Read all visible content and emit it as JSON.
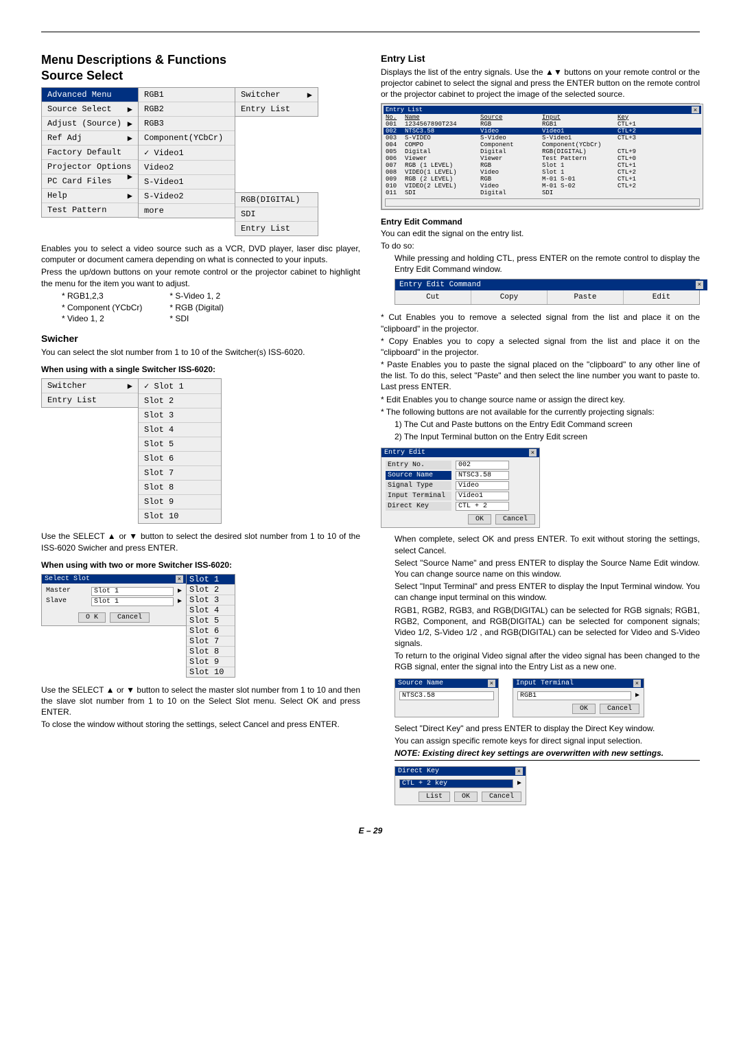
{
  "page_number": "E – 29",
  "left": {
    "h1a": "Menu Descriptions & Functions",
    "h1b": "Source Select",
    "advanced_menu": {
      "title": "Advanced Menu",
      "items": [
        {
          "label": "Source Select",
          "arrow": true
        },
        {
          "label": "Adjust (Source)",
          "arrow": true
        },
        {
          "label": "Ref Adj",
          "arrow": true
        },
        {
          "label": "Factory Default"
        },
        {
          "label": "Projector Options",
          "arrow": true
        },
        {
          "label": "PC Card Files"
        },
        {
          "label": "Help",
          "arrow": true
        },
        {
          "label": "Test Pattern"
        }
      ]
    },
    "source_col1": [
      "RGB1",
      "RGB2",
      "RGB3",
      "Component(YCbCr)",
      "Video1",
      "Video2",
      "S-Video1",
      "S-Video2",
      "more"
    ],
    "source_video1_checked": true,
    "source_col2a": [
      "Switcher",
      "Entry List"
    ],
    "source_col2b": [
      "RGB(DIGITAL)",
      "SDI",
      "Entry List"
    ],
    "p1": "Enables you to select a video source such as a VCR, DVD player, laser disc player, computer or document camera depending on what is connected to your inputs.",
    "p2": "Press the up/down buttons on your remote control or the projector cabinet to highlight the menu for the item you want to adjust.",
    "src_left": [
      "* RGB1,2,3",
      "* Component (YCbCr)",
      "* Video 1, 2"
    ],
    "src_right": [
      "* S-Video 1, 2",
      "* RGB (Digital)",
      "* SDI"
    ],
    "h2_swicher": "Swicher",
    "sw_p1": "You can select the slot number from 1 to 10 of the Switcher(s) ISS-6020.",
    "sw_h3a": "When using with a single Switcher ISS-6020:",
    "sw_menu_left": [
      "Switcher",
      "Entry List"
    ],
    "sw_slots": [
      "Slot 1",
      "Slot 2",
      "Slot 3",
      "Slot 4",
      "Slot 5",
      "Slot 6",
      "Slot 7",
      "Slot 8",
      "Slot 9",
      "Slot 10"
    ],
    "sw_p2": "Use the SELECT ▲ or ▼ button to select the desired slot number from 1 to 10 of the ISS-6020 Swicher and press ENTER.",
    "sw_h3b": "When using with two or more Switcher ISS-6020:",
    "select_slot": {
      "title": "Select Slot",
      "rows": [
        {
          "label": "Master",
          "value": "Slot 1"
        },
        {
          "label": "Slave",
          "value": "Slot 1"
        }
      ],
      "ok": "O K",
      "cancel": "Cancel",
      "dropdown": [
        "Slot 1",
        "Slot 2",
        "Slot 3",
        "Slot 4",
        "Slot 5",
        "Slot 6",
        "Slot 7",
        "Slot 8",
        "Slot 9",
        "Slot 10"
      ]
    },
    "sw_p3": "Use the SELECT ▲ or ▼ button to select the master slot number from 1 to 10 and then the slave slot number from 1 to 10 on the Select Slot menu. Select OK and press ENTER.",
    "sw_p4": "To close the window without storing the settings, select Cancel and press ENTER."
  },
  "right": {
    "h2_entry": "Entry List",
    "el_p1": "Displays the list of the entry signals. Use the ▲▼ buttons on your remote control or the projector cabinet to select the signal and press the ENTER button on the remote control or the projector cabinet to project the image of the selected source.",
    "entry_list": {
      "title": "Entry List",
      "headers": [
        "No.",
        "Name",
        "Source",
        "Input",
        "Key"
      ],
      "rows": [
        [
          "001",
          "1234567890T234",
          "RGB",
          "RGB1",
          "CTL+1"
        ],
        [
          "002",
          "NTSC3.58",
          "Video",
          "Video1",
          "CTL+2"
        ],
        [
          "003",
          "S-VIDEO",
          "S-Video",
          "S-Video1",
          "CTL+3"
        ],
        [
          "004",
          "COMPO",
          "Component",
          "Component(YCbCr)",
          ""
        ],
        [
          "005",
          "Digital",
          "Digital",
          "RGB(DIGITAL)",
          "CTL+9"
        ],
        [
          "006",
          "Viewer",
          "Viewer",
          "Test Pattern",
          "CTL+0"
        ],
        [
          "007",
          "RGB   (1 LEVEL)",
          "RGB",
          "Slot 1",
          "CTL+1"
        ],
        [
          "008",
          "VIDEO(1 LEVEL)",
          "Video",
          "Slot 1",
          "CTL+2"
        ],
        [
          "009",
          "RGB   (2 LEVEL)",
          "RGB",
          "M-01 S-01",
          "CTL+1"
        ],
        [
          "010",
          "VIDEO(2 LEVEL)",
          "Video",
          "M-01 S-02",
          "CTL+2"
        ],
        [
          "011",
          "SDI",
          "Digital",
          "SDI",
          ""
        ]
      ],
      "selected_row": 1
    },
    "h3_eec": "Entry Edit Command",
    "eec_p1": "You can edit the signal on the entry list.",
    "eec_p2": "To do so:",
    "eec_p3": "While pressing and holding CTL, press ENTER on the remote control to display the Entry Edit Command window.",
    "eec_bar": {
      "title": "Entry Edit Command",
      "buttons": [
        "Cut",
        "Copy",
        "Paste",
        "Edit"
      ]
    },
    "bul_cut": "Cut Enables you to remove a selected signal from the list and place it on the \"clipboard\" in the projector.",
    "bul_copy": "Copy Enables you to copy a selected signal from the list and place it on the \"clipboard\" in the projector.",
    "bul_paste": "Paste Enables you to paste the signal placed on the \"clipboard\" to any other line of the list. To do this, select \"Paste\" and then select the line number you want to paste to. Last press ENTER.",
    "bul_edit": "Edit Enables you to change source name or assign the direct key.",
    "bul_follow": "The following buttons are not available for the currently projecting signals:",
    "sub1": "1) The Cut and Paste buttons on the Entry Edit Command screen",
    "sub2": "2) The Input Terminal button on the Entry Edit screen",
    "entry_edit": {
      "title": "Entry Edit",
      "fields": [
        {
          "label": "Entry No.",
          "value": "002",
          "sel": false
        },
        {
          "label": "Source Name",
          "value": "NTSC3.58",
          "sel": true
        },
        {
          "label": "Signal Type",
          "value": "Video",
          "sel": false
        },
        {
          "label": "Input Terminal",
          "value": "Video1",
          "sel": false
        },
        {
          "label": "Direct Key",
          "value": "CTL + 2",
          "sel": false
        }
      ],
      "ok": "OK",
      "cancel": "Cancel"
    },
    "ee_p1": "When complete, select OK and press ENTER. To exit without storing the settings, select Cancel.",
    "ee_p2": "Select \"Source Name\" and press ENTER to display the Source Name Edit window. You can change source name on this window.",
    "ee_p3": "Select \"Input Terminal\" and press ENTER to display the Input Terminal window. You can change input terminal on this window.",
    "ee_p4": "RGB1, RGB2, RGB3, and RGB(DIGITAL) can be selected for RGB signals; RGB1, RGB2, Component, and RGB(DIGITAL) can be selected for component signals; Video 1/2, S-Video 1/2 , and RGB(DIGITAL) can be selected for Video and S-Video signals.",
    "ee_p5": "To return to the original Video signal after the video signal has been changed to the RGB signal, enter the signal into the Entry List as a new one.",
    "source_name_dlg": {
      "title": "Source Name",
      "value": "NTSC3.58"
    },
    "input_term_dlg": {
      "title": "Input Terminal",
      "value": "RGB1",
      "ok": "OK",
      "cancel": "Cancel"
    },
    "dk_p1": "Select \"Direct Key\" and press ENTER to display the Direct Key window.",
    "dk_p2": "You can assign specific remote keys for direct signal input selection.",
    "dk_note": "NOTE: Existing direct key settings are overwritten with new settings.",
    "direct_key_dlg": {
      "title": "Direct Key",
      "value": "CTL + 2 key",
      "list": "List",
      "ok": "OK",
      "cancel": "Cancel"
    }
  }
}
